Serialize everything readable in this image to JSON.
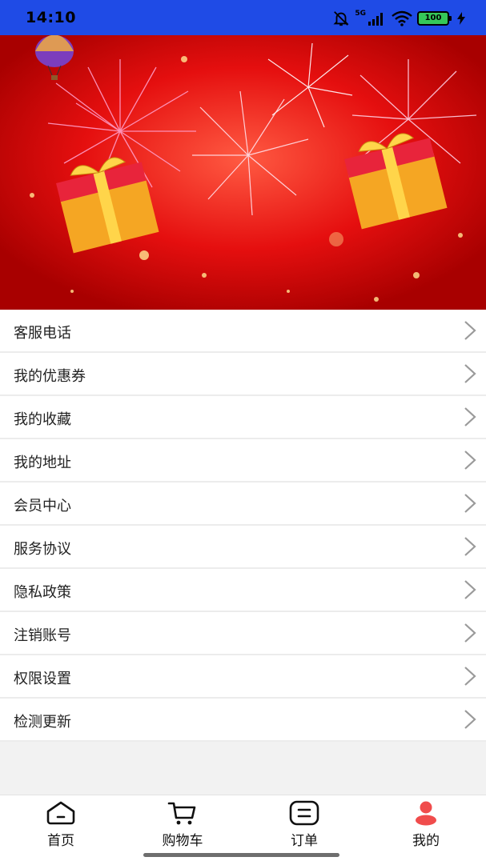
{
  "status_bar": {
    "time": "14:10",
    "network": "5G",
    "battery": "100",
    "icons": [
      "bell-muted-icon",
      "signal-icon",
      "wifi-icon",
      "battery-icon",
      "charging-icon"
    ]
  },
  "banner": {
    "theme": "fireworks-and-gift-boxes",
    "colors": {
      "background": "#e80d0d",
      "gift": "#f5a623",
      "ribbon": "#ffd54a",
      "box_red": "#e8243b"
    }
  },
  "menu": {
    "items": [
      {
        "label": "客服电话",
        "icon": "chevron-right-icon"
      },
      {
        "label": "我的优惠券",
        "icon": "chevron-right-icon"
      },
      {
        "label": "我的收藏",
        "icon": "chevron-right-icon"
      },
      {
        "label": "我的地址",
        "icon": "chevron-right-icon"
      },
      {
        "label": "会员中心",
        "icon": "chevron-right-icon"
      },
      {
        "label": "服务协议",
        "icon": "chevron-right-icon"
      },
      {
        "label": "隐私政策",
        "icon": "chevron-right-icon"
      },
      {
        "label": "注销账号",
        "icon": "chevron-right-icon"
      },
      {
        "label": "权限设置",
        "icon": "chevron-right-icon"
      },
      {
        "label": "检测更新",
        "icon": "chevron-right-icon"
      }
    ]
  },
  "tab_bar": {
    "active_color": "#f04c4c",
    "tabs": [
      {
        "label": "首页",
        "icon": "home-icon",
        "active": false
      },
      {
        "label": "购物车",
        "icon": "cart-icon",
        "active": false
      },
      {
        "label": "订单",
        "icon": "order-icon",
        "active": false
      },
      {
        "label": "我的",
        "icon": "user-icon",
        "active": true
      }
    ]
  }
}
